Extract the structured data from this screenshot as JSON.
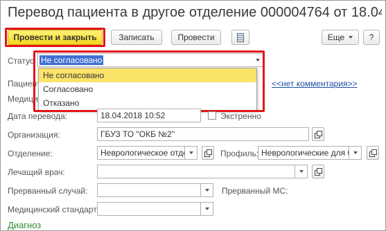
{
  "window": {
    "title": "Перевод пациента в другое отделение 000004764 от 18.04....",
    "more": "⋮"
  },
  "toolbar": {
    "post_close_label": "Провести и закрыть",
    "save_label": "Записать",
    "post_label": "Провести",
    "more_label": "Еще",
    "help_label": "?"
  },
  "form": {
    "status": {
      "label": "Статус:",
      "value": "Не согласовано",
      "options": [
        "Не согласовано",
        "Согласовано",
        "Отказано"
      ]
    },
    "patient": {
      "label": "Пациент"
    },
    "medic": {
      "label": "Медици"
    },
    "comment_link": "<<нет комментария>>",
    "transfer_date": {
      "label": "Дата перевода:",
      "value": "18.04.2018 10:52"
    },
    "urgent": {
      "label": "Экстренно"
    },
    "organization": {
      "label": "Организация:",
      "value": "ГБУЗ ТО \"ОКБ №2\""
    },
    "department": {
      "label": "Отделение:",
      "value": "Неврологическое отдел"
    },
    "profile": {
      "label": "Профиль:",
      "value": "Неврологические для бо"
    },
    "doctor": {
      "label": "Лечащий врач:",
      "value": ""
    },
    "interrupted_case": {
      "label": "Прерванный случай:",
      "value": ""
    },
    "interrupted_ms": {
      "label": "Прерванный МС:"
    },
    "med_standard": {
      "label": "Медицинский стандарт:",
      "value": ""
    },
    "diagnosis_section": "Диагноз"
  },
  "colors": {
    "primary_button": "#f7d91c",
    "highlight_frame": "#e3141b",
    "selected_option": "#fbe36a",
    "link": "#1f4fa0",
    "section_title": "#2f8a2f"
  }
}
